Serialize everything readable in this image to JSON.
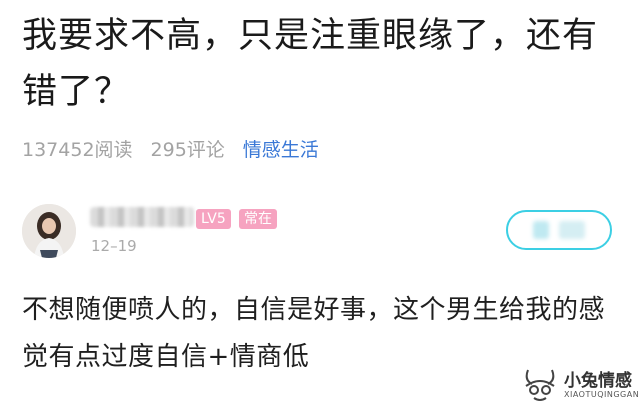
{
  "post": {
    "title": "我要求不高，只是注重眼缘了，还有错了？",
    "reads": "137452阅读",
    "comments": "295评论",
    "category": "情感生活"
  },
  "comment": {
    "level_badge": "LV5",
    "status_badge": "常在",
    "date": "12–19",
    "text": "不想随便喷人的，自信是好事，这个男生给我的感觉有点过度自信+情商低"
  },
  "watermark": {
    "name": "小兔情感",
    "sub": "XIAOTUQINGGAN"
  },
  "colors": {
    "category": "#3a78d6",
    "badge": "#f6a3c0",
    "follow_border": "#3ccfe4",
    "meta": "#a3a3a3"
  }
}
